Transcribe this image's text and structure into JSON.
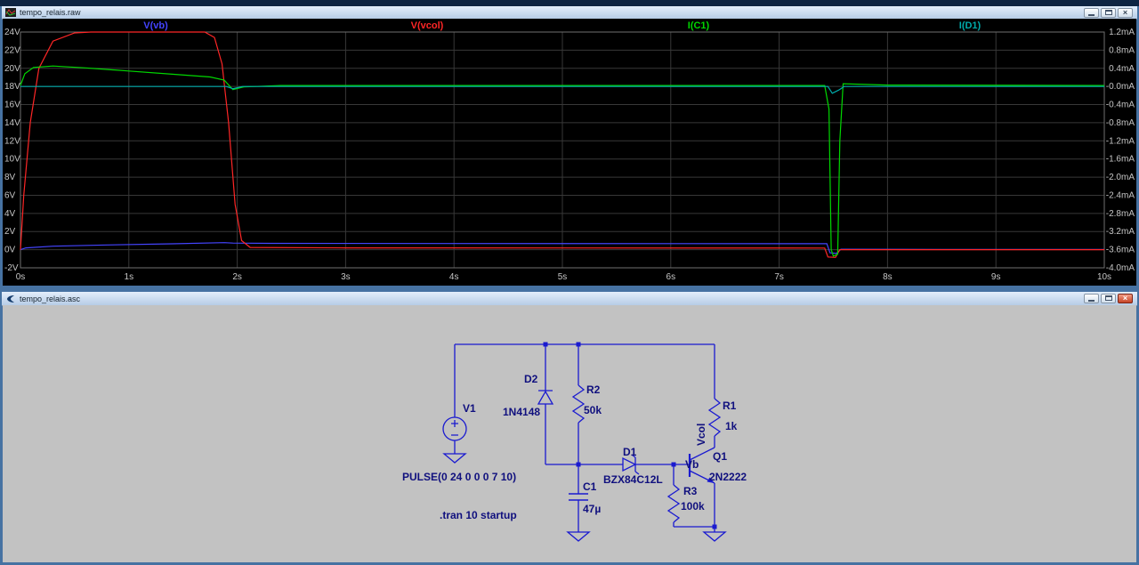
{
  "windows": {
    "waveform": {
      "title": "tempo_relais.raw"
    },
    "schematic": {
      "title": "tempo_relais.asc"
    }
  },
  "window_controls": {
    "close": "×"
  },
  "chart_data": {
    "type": "line",
    "title": "",
    "background": "#000000",
    "grid": true,
    "legend_position": "top",
    "x_axis": {
      "min": 0,
      "max": 10,
      "step": 1,
      "unit": "s"
    },
    "left_axis": {
      "min": -2,
      "max": 24,
      "step": 2,
      "unit": "V"
    },
    "right_axis": {
      "min": -4.0,
      "max": 1.2,
      "step": 0.4,
      "unit": "mA"
    },
    "series": [
      {
        "name": "V(vb)",
        "color": "#4444ff",
        "axis": "left",
        "points": [
          [
            0,
            0
          ],
          [
            0.05,
            0.2
          ],
          [
            0.3,
            0.38
          ],
          [
            0.8,
            0.52
          ],
          [
            1.4,
            0.65
          ],
          [
            1.88,
            0.78
          ],
          [
            1.96,
            0.73
          ],
          [
            2.3,
            0.7
          ],
          [
            4,
            0.68
          ],
          [
            7.44,
            0.66
          ],
          [
            7.47,
            -0.35
          ],
          [
            7.53,
            -0.4
          ],
          [
            7.57,
            0.05
          ],
          [
            8.5,
            0.03
          ],
          [
            10,
            0.02
          ]
        ]
      },
      {
        "name": "V(vcol)",
        "color": "#ff2626",
        "axis": "left",
        "points": [
          [
            0,
            0
          ],
          [
            0.03,
            6
          ],
          [
            0.09,
            14
          ],
          [
            0.17,
            20
          ],
          [
            0.3,
            23
          ],
          [
            0.5,
            23.9
          ],
          [
            0.65,
            24
          ],
          [
            1.7,
            24
          ],
          [
            1.79,
            23.4
          ],
          [
            1.86,
            20.5
          ],
          [
            1.92,
            14
          ],
          [
            1.98,
            5
          ],
          [
            2.04,
            1
          ],
          [
            2.12,
            0.25
          ],
          [
            3,
            0.2
          ],
          [
            7.42,
            0.18
          ],
          [
            7.45,
            -0.8
          ],
          [
            7.52,
            -0.85
          ],
          [
            7.56,
            0
          ],
          [
            10,
            0
          ]
        ]
      },
      {
        "name": "I(C1)",
        "color": "#00d800",
        "axis": "right",
        "points": [
          [
            0,
            0.02
          ],
          [
            0.04,
            0.28
          ],
          [
            0.12,
            0.42
          ],
          [
            0.3,
            0.45
          ],
          [
            0.6,
            0.41
          ],
          [
            1.0,
            0.34
          ],
          [
            1.4,
            0.27
          ],
          [
            1.75,
            0.21
          ],
          [
            1.88,
            0.14
          ],
          [
            1.96,
            -0.07
          ],
          [
            2.06,
            -0.01
          ],
          [
            2.4,
            0.02
          ],
          [
            5,
            0.02
          ],
          [
            7.42,
            0.02
          ],
          [
            7.46,
            -0.5
          ],
          [
            7.48,
            -3.6
          ],
          [
            7.5,
            -3.74
          ],
          [
            7.54,
            -3.7
          ],
          [
            7.56,
            -1.2
          ],
          [
            7.59,
            0.06
          ],
          [
            8,
            0.03
          ],
          [
            10,
            0.02
          ]
        ]
      },
      {
        "name": "I(D1)",
        "color": "#00aaaa",
        "axis": "right",
        "points": [
          [
            0,
            0
          ],
          [
            1.9,
            0
          ],
          [
            1.96,
            -0.05
          ],
          [
            2.05,
            0
          ],
          [
            7.45,
            0
          ],
          [
            7.49,
            -0.15
          ],
          [
            7.55,
            -0.08
          ],
          [
            7.6,
            0
          ],
          [
            10,
            0
          ]
        ]
      }
    ]
  },
  "schematic": {
    "components": {
      "v1": {
        "name": "V1",
        "value": "PULSE(0 24 0 0 0 7 10)"
      },
      "d2": {
        "name": "D2",
        "value": "1N4148"
      },
      "r2": {
        "name": "R2",
        "value": "50k"
      },
      "c1": {
        "name": "C1",
        "value": "47µ"
      },
      "d1": {
        "name": "D1",
        "value": "BZX84C12L"
      },
      "r3": {
        "name": "R3",
        "value": "100k"
      },
      "r1": {
        "name": "R1",
        "value": "1k"
      },
      "q1": {
        "name": "Q1",
        "value": "2N2222"
      }
    },
    "net_labels": {
      "vcol": "Vcol",
      "vb": "Vb"
    },
    "directive": ".tran 10 startup"
  }
}
